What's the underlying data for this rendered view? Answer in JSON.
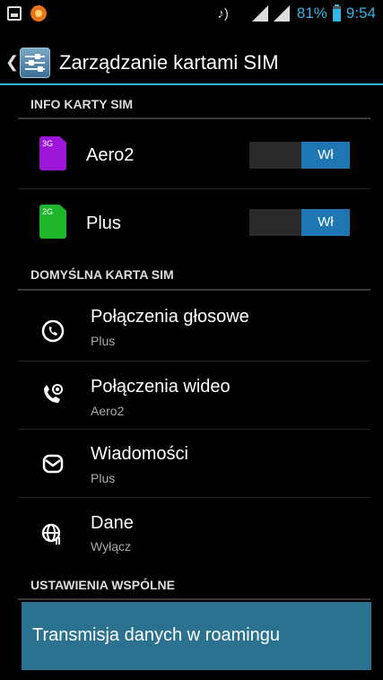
{
  "status_bar": {
    "battery_percent": "81%",
    "time": "9:54"
  },
  "action_bar": {
    "title": "Zarządzanie kartami SIM"
  },
  "sections": {
    "info": "INFO KARTY SIM",
    "default": "DOMYŚLNA KARTA SIM",
    "common": "USTAWIENIA WSPÓLNE"
  },
  "sims": [
    {
      "badge": "3G",
      "name": "Aero2",
      "toggle_label": "Wł",
      "color": "#9b16d6"
    },
    {
      "badge": "2G",
      "name": "Plus",
      "toggle_label": "Wł",
      "color": "#1fb52a"
    }
  ],
  "defaults": [
    {
      "title": "Połączenia głosowe",
      "value": "Plus",
      "icon": "phone-icon"
    },
    {
      "title": "Połączenia wideo",
      "value": "Aero2",
      "icon": "video-call-icon"
    },
    {
      "title": "Wiadomości",
      "value": "Plus",
      "icon": "message-icon"
    },
    {
      "title": "Dane",
      "value": "Wyłącz",
      "icon": "data-globe-icon"
    }
  ],
  "roaming": {
    "label": "Transmisja danych w roamingu"
  },
  "colors": {
    "accent": "#33b5e5",
    "toggle_on": "#1e76b2",
    "roaming_bg": "#2a728f"
  }
}
